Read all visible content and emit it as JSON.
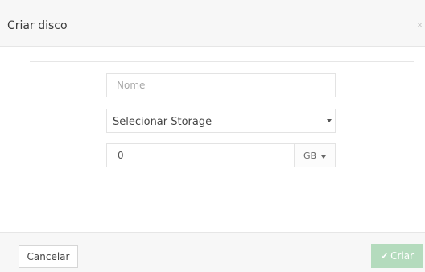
{
  "modal": {
    "title": "Criar disco",
    "close_symbol": "×"
  },
  "form": {
    "name_placeholder": "Nome",
    "name_value": "",
    "storage_select_value": "Selecionar Storage",
    "size_value": "0",
    "size_unit": "GB"
  },
  "footer": {
    "cancel_label": "Cancelar",
    "create_label": "Criar",
    "create_icon": "check-icon"
  },
  "colors": {
    "create_button_bg": "#b4dbbd",
    "header_bg": "#f7f7f7"
  }
}
